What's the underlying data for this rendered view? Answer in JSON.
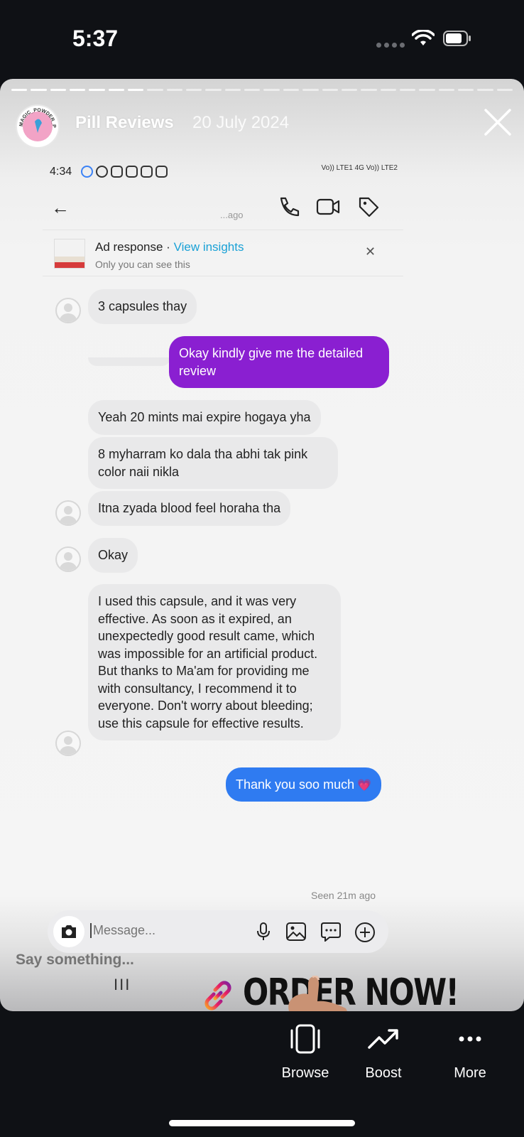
{
  "status_bar": {
    "time": "5:37"
  },
  "story": {
    "account_name": "Pill Reviews",
    "date": "20 July 2024",
    "avatar_text": "MAGIC_POWDER_PK",
    "progress_total": 26,
    "progress_done": 7
  },
  "inner_screenshot": {
    "status_time": "4:34",
    "network": "Vo)) LTE1  4G  Vo)) LTE2",
    "header_subtitle": "...ago",
    "ad_response": {
      "label": "Ad response · ",
      "link": "View insights",
      "subtitle": "Only you can see this"
    },
    "messages": [
      {
        "type": "received",
        "text": "3 capsules thay"
      },
      {
        "type": "sent",
        "text": "Okay kindly give me the detailed review"
      },
      {
        "type": "received",
        "text": "Yeah 20 mints mai expire hogaya yha"
      },
      {
        "type": "received",
        "text": "8 myharram ko dala tha abhi tak pink color naii nikla"
      },
      {
        "type": "received",
        "text": "Itna zyada blood feel horaha tha"
      },
      {
        "type": "received",
        "text": "Okay"
      },
      {
        "type": "received",
        "text": "I used this capsule, and it was very effective. As soon as it expired, an unexpectedly good result came, which was impossible for an artificial product. But thanks to Ma'am for providing me with consultancy, I recommend it to everyone. Don't worry about bleeding; use this capsule for effective results."
      },
      {
        "type": "sent",
        "text": "Thank you soo much",
        "emoji": "💗"
      }
    ],
    "seen": "Seen 21m ago",
    "composer_placeholder": "Message..."
  },
  "sticker": {
    "text": "ORDER NOW!"
  },
  "handle_text": "III",
  "reply_placeholder": "Say something...",
  "actions": {
    "browse": "Browse",
    "boost": "Boost",
    "more": "More"
  },
  "colors": {
    "sent_bubble": "#8a1fd1",
    "sent_bubble_blue": "#2f7bf1",
    "received_bubble": "#e9e9ea",
    "link": "#1aa1d6"
  }
}
